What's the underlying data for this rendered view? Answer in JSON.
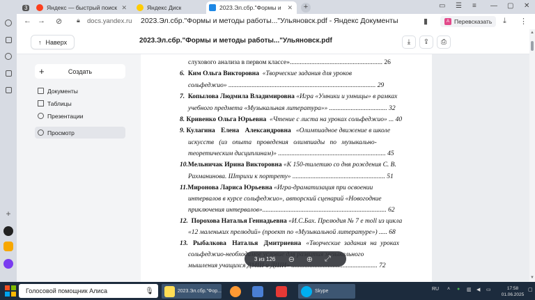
{
  "browser": {
    "tabs": [
      {
        "label": "Яндекс — быстрый поиск",
        "favicon_color": "#fc3f1d"
      },
      {
        "label": "Яндекс Диск",
        "favicon_color": "#ffcc00"
      },
      {
        "label": "2023.Эл.сбр.\"Формы и",
        "favicon_color": "#1e88e5"
      }
    ],
    "tab_count": "3",
    "new_tab_symbol": "+",
    "url_domain": "docs.yandex.ru",
    "page_title": "2023.Эл.сбр.\"Формы и методы работы...\"Ульяновск.pdf - Яндекс Документы",
    "translate_label": "Перевсказать"
  },
  "viewer": {
    "back_label": "Наверх",
    "doc_name": "2023.Эл.сбр.\"Формы и методы работы...\"Ульяновск.pdf",
    "sidebar": {
      "create_label": "Создать",
      "items": [
        {
          "label": "Документы",
          "icon": "document-icon"
        },
        {
          "label": "Таблицы",
          "icon": "table-icon"
        },
        {
          "label": "Презентации",
          "icon": "presentation-icon"
        },
        {
          "label": "Просмотр",
          "icon": "view-icon"
        }
      ]
    },
    "page_indicator": "3 из 126"
  },
  "toc": {
    "lines": [
      {
        "text": "слухового анализа в первом классе»........................................................ 26"
      },
      {
        "text": "соль­феджио» ......................................................................................... 29"
      },
      {
        "text": "учебного предмета «Музыкальная литература»» ................................... 32"
      },
      {
        "text": "искусств (из опыта проведения олимпиады по музыкально-"
      },
      {
        "text": "теоретическим дисциплинам)» ................................................................. 45"
      },
      {
        "text": "Рахманинова. Штрихи к портрету» ........................................................ 51"
      },
      {
        "text": "интервалов в курсе сольфеджио», авторский сценарий «Новогодние"
      },
      {
        "text": "приключения интервалов»........................................................................... 62"
      },
      {
        "text": "«12 маленьких прелюдий» (проект по «Музыкальной литературе») ..... 68"
      },
      {
        "text": "сольфеджио-необходимое условие для развития музыкального"
      },
      {
        "text": "мышления учащихся ДМШ и ДШИ» .................................................... 72"
      }
    ],
    "entries": [
      {
        "num": "6.",
        "author": "Ким Ольга Викторовна",
        "work": "«Творческие задания для уроков"
      },
      {
        "num": "7.",
        "author": "Копылова Людмила Владимировна",
        "work": "«Игра «Умники и умницы» в рамках"
      },
      {
        "num": "8.",
        "author": "Кривенко Ольга Юрьевна",
        "work": "«Чтение с листа на уроках сольфеджио» ... 40"
      },
      {
        "num": "9.",
        "author": "Кулагина Елена Александровна",
        "work": "«Олимпиадное движение в школе"
      },
      {
        "num": "10.",
        "author": "Мельничак Ирина Викторовна",
        "work": "«К 150-тилетию со дня рождения С. В."
      },
      {
        "num": "11.",
        "author": "Миронова Лариса Юрьевна",
        "work": "«Игра-драматизация при освоении"
      },
      {
        "num": "12.",
        "author": "Порохова Наталья Геннадьевна",
        "work": "«И.С.Бах. Прелюдия № 7 e moll из цикла"
      },
      {
        "num": "13.",
        "author": "Рыбалкова Наталья Дмитриевна",
        "work": "«Творческие задания на уроках"
      }
    ]
  },
  "taskbar": {
    "assistant_placeholder": "Голосовой помощник Алиса",
    "items": [
      {
        "label": "2023.Эл.сбр.\"Фор...",
        "color": "#ffdd55"
      },
      {
        "label": "",
        "color": "#ff9933"
      },
      {
        "label": "",
        "color": "#4a7fd4"
      },
      {
        "label": "",
        "color": "#e53935"
      },
      {
        "label": "Skype",
        "color": "#00aff0"
      }
    ],
    "language": "RU",
    "time": "17:58",
    "date": "01.06.2025"
  }
}
